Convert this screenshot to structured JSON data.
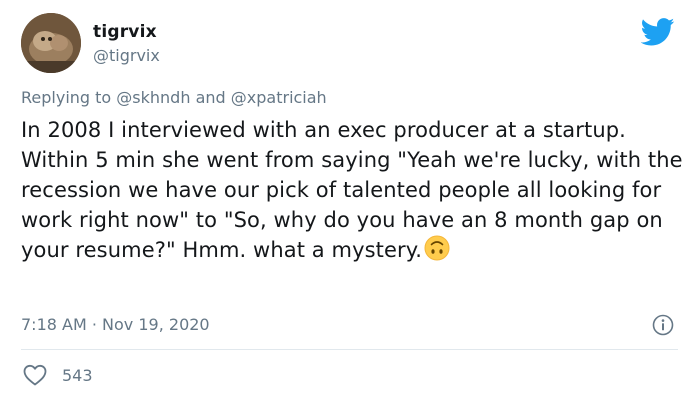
{
  "author": {
    "display_name": "tigrvix",
    "handle": "@tigrvix"
  },
  "reply": {
    "prefix": "Replying to",
    "mention_1": "@skhndh",
    "conjunction": "and",
    "mention_2": "@xpatriciah"
  },
  "tweet": {
    "text": "In 2008 I interviewed with an exec producer at a startup. Within 5 min she went from saying \"Yeah we're lucky, with the recession we have our pick of talented people all looking for work right now\" to \"So, why do you have an 8 month gap on your resume?\" Hmm. what a mystery.",
    "emoji": "upside-down-face-emoji",
    "time": "7:18 AM",
    "separator": "·",
    "date": "Nov 19, 2020"
  },
  "actions": {
    "like_count": "543"
  },
  "icons": {
    "brand": "twitter-bird-icon",
    "info": "info-icon",
    "like": "heart-icon"
  },
  "colors": {
    "brand_blue": "#1da1f2",
    "secondary_text": "#657786",
    "primary_text": "#14171a",
    "divider": "#e1e8ed"
  }
}
